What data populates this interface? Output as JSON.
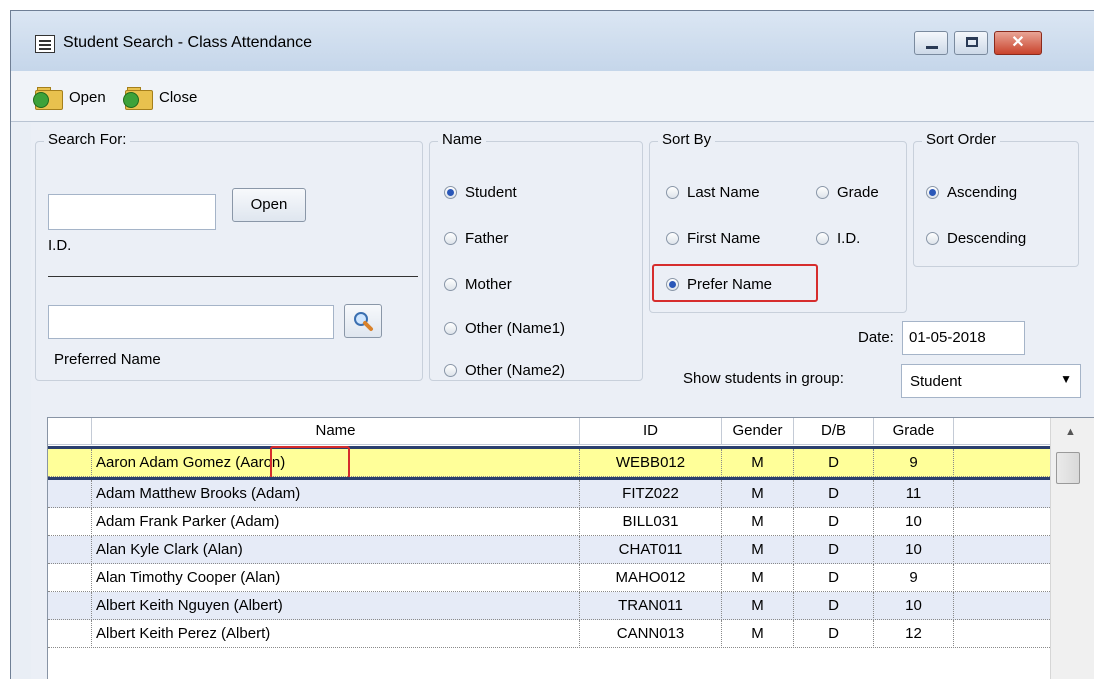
{
  "window": {
    "title": "Student Search - Class Attendance",
    "close_glyph": "✕",
    "accent_close": "#c9432c"
  },
  "toolbar": {
    "open_label": "Open",
    "close_label": "Close"
  },
  "search_for": {
    "legend": "Search For:",
    "id_value": "",
    "open_button": "Open",
    "id_label": "I.D.",
    "preferred_value": "",
    "preferred_label": "Preferred Name"
  },
  "name_group": {
    "legend": "Name",
    "options": [
      {
        "label": "Student",
        "selected": true
      },
      {
        "label": "Father",
        "selected": false
      },
      {
        "label": "Mother",
        "selected": false
      },
      {
        "label": "Other (Name1)",
        "selected": false
      },
      {
        "label": "Other (Name2)",
        "selected": false
      }
    ]
  },
  "sort_by": {
    "legend": "Sort By",
    "options": [
      {
        "label": "Last Name",
        "selected": false
      },
      {
        "label": "Grade",
        "selected": false
      },
      {
        "label": "First Name",
        "selected": false
      },
      {
        "label": "I.D.",
        "selected": false
      },
      {
        "label": "Prefer Name",
        "selected": true
      }
    ]
  },
  "sort_order": {
    "legend": "Sort Order",
    "options": [
      {
        "label": "Ascending",
        "selected": true
      },
      {
        "label": "Descending",
        "selected": false
      }
    ]
  },
  "date": {
    "label": "Date:",
    "value": "01-05-2018"
  },
  "group_filter": {
    "label": "Show students in group:",
    "value": "Student"
  },
  "table": {
    "columns": [
      "Name",
      "ID",
      "Gender",
      "D/B",
      "Grade"
    ],
    "rows": [
      {
        "name_plain": "Aaron Adam Gomez ",
        "name_pref": "(Aaron)",
        "id": "WEBB012",
        "gender": "M",
        "db": "D",
        "grade": "9"
      },
      {
        "name": "Adam Matthew Brooks (Adam)",
        "id": "FITZ022",
        "gender": "M",
        "db": "D",
        "grade": "11"
      },
      {
        "name": "Adam Frank Parker (Adam)",
        "id": "BILL031",
        "gender": "M",
        "db": "D",
        "grade": "10"
      },
      {
        "name": "Alan Kyle Clark (Alan)",
        "id": "CHAT011",
        "gender": "M",
        "db": "D",
        "grade": "10"
      },
      {
        "name": "Alan Timothy Cooper (Alan)",
        "id": "MAHO012",
        "gender": "M",
        "db": "D",
        "grade": "9"
      },
      {
        "name": "Albert Keith Nguyen (Albert)",
        "id": "TRAN011",
        "gender": "M",
        "db": "D",
        "grade": "10"
      },
      {
        "name": "Albert Keith Perez (Albert)",
        "id": "CANN013",
        "gender": "M",
        "db": "D",
        "grade": "12"
      }
    ],
    "colors": {
      "selected": "#ffff99",
      "alt": "#e6ebf7",
      "plain": "#ffffff",
      "highlight": "#d62d2d"
    }
  }
}
